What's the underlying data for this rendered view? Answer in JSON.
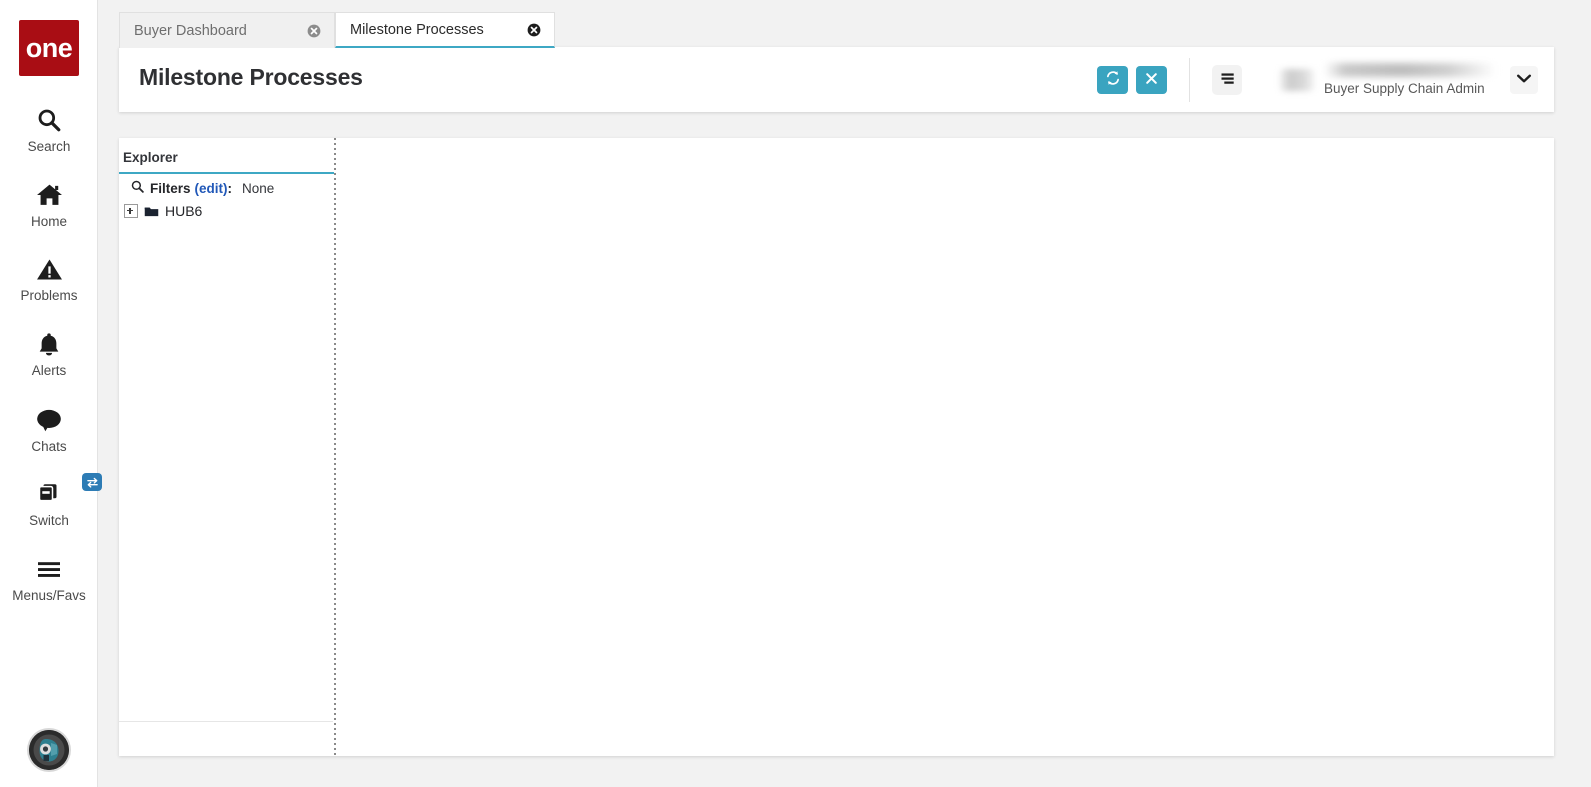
{
  "app": {
    "brand": "one",
    "brand_color": "#a90d14",
    "accent_teal": "#3aa4c0",
    "link_blue": "#2158b8",
    "badge_blue": "#2d7cb5"
  },
  "sidebar": {
    "items": [
      {
        "label": "Search",
        "icon": "search-icon"
      },
      {
        "label": "Home",
        "icon": "home-icon"
      },
      {
        "label": "Problems",
        "icon": "warning-triangle-icon"
      },
      {
        "label": "Alerts",
        "icon": "bell-icon"
      },
      {
        "label": "Chats",
        "icon": "chat-bubble-icon"
      },
      {
        "label": "Switch",
        "icon": "switch-cards-icon"
      },
      {
        "label": "Menus/Favs",
        "icon": "hamburger-icon"
      }
    ],
    "avatar": "user-avatar"
  },
  "tabs": [
    {
      "label": "Buyer Dashboard",
      "active": false,
      "close_icon": "close-circle-icon"
    },
    {
      "label": "Milestone Processes",
      "active": true,
      "close_icon": "close-circle-icon"
    }
  ],
  "header": {
    "title": "Milestone Processes",
    "actions": [
      {
        "name": "refresh-button",
        "icon": "refresh-icon"
      },
      {
        "name": "close-button",
        "icon": "x-icon"
      }
    ],
    "menu_button": {
      "name": "menu-button",
      "icon": "menu-lines-icon"
    },
    "user": {
      "name": "",
      "role": "Buyer Supply Chain Admin",
      "caret_icon": "chevron-down-icon"
    }
  },
  "explorer": {
    "title": "Explorer",
    "filters": {
      "icon": "search-icon",
      "label": "Filters",
      "edit_label": "(edit)",
      "colon": ":",
      "value": "None"
    },
    "tree": [
      {
        "label": "HUB6",
        "expander": "plus-box-icon",
        "folder_icon": "folder-icon",
        "expanded": false
      }
    ]
  }
}
